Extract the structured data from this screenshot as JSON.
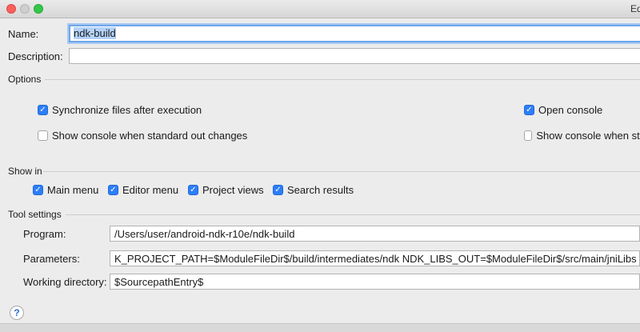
{
  "window": {
    "title": "Ed"
  },
  "name": {
    "label": "Name:",
    "value": "ndk-build"
  },
  "description": {
    "label": "Description:",
    "value": ""
  },
  "options": {
    "title": "Options",
    "sync_files": {
      "label": "Synchronize files after execution",
      "checked": true
    },
    "open_console": {
      "label": "Open console",
      "checked": true
    },
    "show_console_stdout": {
      "label": "Show console when standard out changes",
      "checked": false
    },
    "show_console_stderr": {
      "label": "Show console when stan",
      "checked": false
    }
  },
  "show_in": {
    "title": "Show in",
    "items": [
      {
        "label": "Main menu",
        "checked": true
      },
      {
        "label": "Editor menu",
        "checked": true
      },
      {
        "label": "Project views",
        "checked": true
      },
      {
        "label": "Search results",
        "checked": true
      }
    ]
  },
  "tool_settings": {
    "title": "Tool settings",
    "program": {
      "label": "Program:",
      "value": "/Users/user/android-ndk-r10e/ndk-build"
    },
    "parameters": {
      "label": "Parameters:",
      "value": "K_PROJECT_PATH=$ModuleFileDir$/build/intermediates/ndk NDK_LIBS_OUT=$ModuleFileDir$/src/main/jniLibs NDK_APPLI"
    },
    "working_directory": {
      "label": "Working directory:",
      "value": "$SourcepathEntry$"
    }
  },
  "help": {
    "glyph": "?"
  }
}
